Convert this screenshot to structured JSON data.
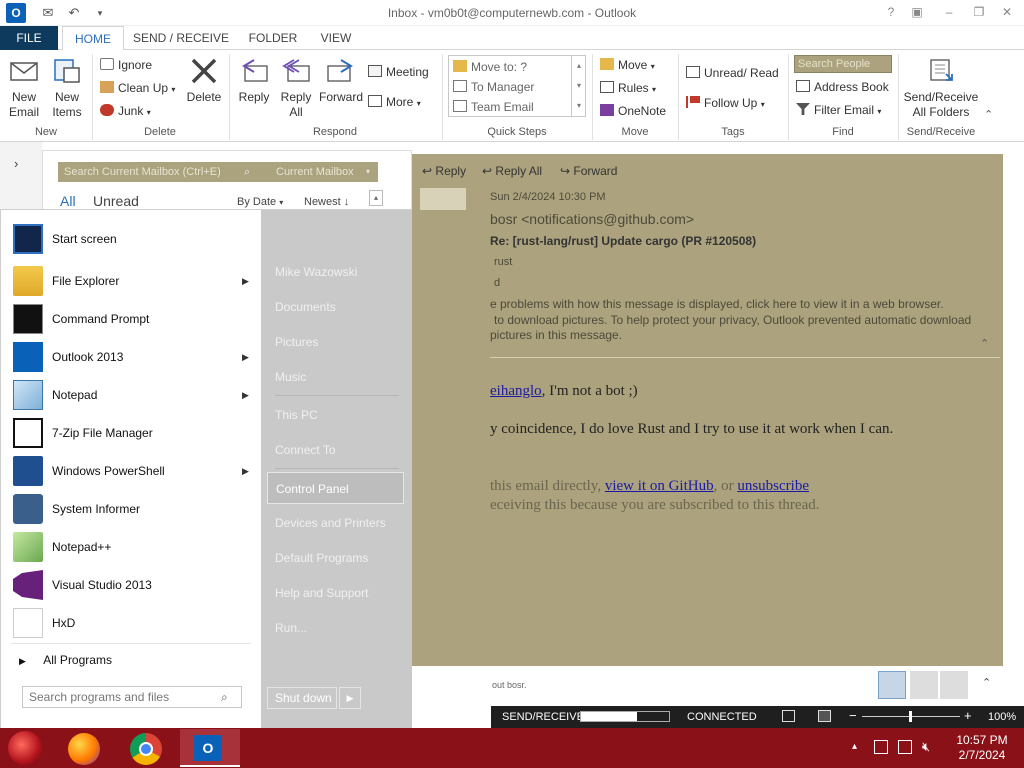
{
  "window": {
    "title": "Inbox - vm0b0t@computernewb.com - Outlook",
    "app_icon_letter": "O"
  },
  "tabs": [
    "FILE",
    "HOME",
    "SEND / RECEIVE",
    "FOLDER",
    "VIEW"
  ],
  "ribbon": {
    "new": {
      "new_email": "New\nEmail",
      "new_items": "New\nItems",
      "label": "New"
    },
    "delete": {
      "ignore": "Ignore",
      "clean_up": "Clean Up",
      "junk": "Junk",
      "delete": "Delete",
      "label": "Delete"
    },
    "respond": {
      "reply": "Reply",
      "reply_all": "Reply\nAll",
      "forward": "Forward",
      "meeting": "Meeting",
      "more": "More",
      "label": "Respond"
    },
    "quick_steps": {
      "items": [
        "Move to: ?",
        "To Manager",
        "Team Email"
      ],
      "label": "Quick Steps"
    },
    "move": {
      "move": "Move",
      "rules": "Rules",
      "onenote": "OneNote",
      "label": "Move"
    },
    "tags": {
      "unread_read": "Unread/ Read",
      "follow_up": "Follow Up",
      "label": "Tags"
    },
    "find": {
      "search_people_placeholder": "Search People",
      "address_book": "Address Book",
      "filter_email": "Filter Email",
      "label": "Find"
    },
    "send_receive": {
      "button": "Send/Receive\nAll Folders",
      "label": "Send/Receive"
    }
  },
  "mail_list": {
    "search_placeholder": "Search Current Mailbox (Ctrl+E)",
    "scope": "Current Mailbox",
    "filter_all": "All",
    "filter_unread": "Unread",
    "sort_by": "By Date",
    "sort_order": "Newest",
    "sort_arrow": "↓"
  },
  "reading_pane": {
    "reply": "Reply",
    "reply_all": "Reply All",
    "forward": "Forward",
    "date": "Sun 2/4/2024 10:30 PM",
    "sender": "bosr <notifications@github.com>",
    "subject": "Re: [rust-lang/rust] Update cargo (PR #120508)",
    "to_fragment": "rust",
    "cc_fragment": "d",
    "info_line_1": "e problems with how this message is displayed, click here to view it in a web browser.",
    "info_line_2": "to download pictures. To help protect your privacy, Outlook prevented automatic download",
    "info_line_3": "pictures in this message.",
    "body_mention": "eihanglo",
    "body_line_1_rest": ", I'm not a bot ;)",
    "body_line_2": "y coincidence, I do love Rust and I try to use it at work when I can.",
    "footer_pre": "this email directly, ",
    "footer_link_1": "view it on GitHub",
    "footer_mid": ", or ",
    "footer_link_2": "unsubscribe",
    "footer_line_2": "eceiving this because you are subscribed to this thread.",
    "people_pane_text": "out bosr."
  },
  "statusbar": {
    "send_receive": "SEND/RECEIVE",
    "progress": 0.64,
    "connected": "CONNECTED",
    "zoom": "100%"
  },
  "start_menu": {
    "pinned": [
      {
        "label": "Start screen",
        "icon": "start-screen-icon",
        "arrow": false
      },
      {
        "label": "File Explorer",
        "icon": "folder-icon",
        "arrow": true
      },
      {
        "label": "Command Prompt",
        "icon": "cmd-icon",
        "arrow": false
      },
      {
        "label": "Outlook 2013",
        "icon": "outlook-icon",
        "arrow": true
      },
      {
        "label": "Notepad",
        "icon": "notepad-icon",
        "arrow": true
      },
      {
        "label": "7-Zip File Manager",
        "icon": "7zip-icon",
        "arrow": false
      },
      {
        "label": "Windows PowerShell",
        "icon": "powershell-icon",
        "arrow": true
      },
      {
        "label": "System Informer",
        "icon": "system-informer-icon",
        "arrow": false
      },
      {
        "label": "Notepad++",
        "icon": "notepadpp-icon",
        "arrow": false
      },
      {
        "label": "Visual Studio 2013",
        "icon": "visual-studio-icon",
        "arrow": false
      },
      {
        "label": "HxD",
        "icon": "hxd-icon",
        "arrow": false
      }
    ],
    "all_programs": "All Programs",
    "search_placeholder": "Search programs and files",
    "right": [
      "Mike Wazowski",
      "Documents",
      "Pictures",
      "Music",
      "This PC",
      "Connect To",
      "Control Panel",
      "Devices and Printers",
      "Default Programs",
      "Help and Support",
      "Run..."
    ],
    "highlighted": "Control Panel",
    "shutdown": "Shut down"
  },
  "taskbar": {
    "time": "10:57 PM",
    "date": "2/7/2024"
  },
  "colors": {
    "accent_blue": "#2a6fbd",
    "file_tab": "#0e3a5e",
    "reading_pane_bg": "#aca37e",
    "taskbar": "#8b1118"
  }
}
